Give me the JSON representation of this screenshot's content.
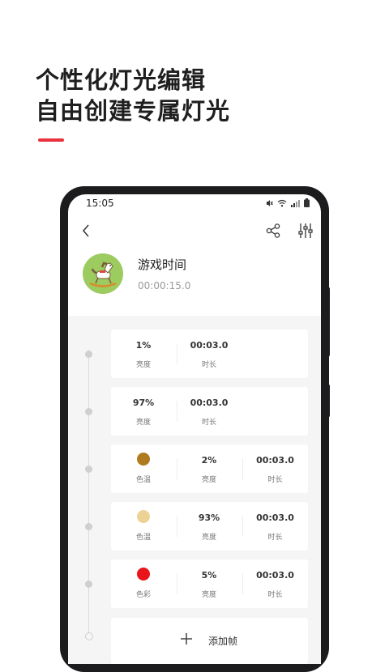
{
  "hero": {
    "line1": "个性化灯光编辑",
    "line2": "自由创建专属灯光",
    "accent_color": "#e8323c"
  },
  "statusbar": {
    "time": "15:05",
    "icons": [
      "mute-icon",
      "wifi-icon",
      "signal-icon",
      "battery-icon"
    ]
  },
  "toolbar": {
    "back_icon": "chevron-left-icon",
    "share_icon": "share-icon",
    "adjust_icon": "sliders-icon"
  },
  "scene": {
    "name": "游戏时间",
    "duration": "00:00:15.0",
    "avatar_icon": "rocking-horse-icon",
    "avatar_color": "#9ccb5f"
  },
  "frames": [
    {
      "cells": [
        {
          "value": "1%",
          "label": "亮度"
        },
        {
          "value": "00:03.0",
          "label": "时长"
        }
      ]
    },
    {
      "cells": [
        {
          "value": "97%",
          "label": "亮度"
        },
        {
          "value": "00:03.0",
          "label": "时长"
        }
      ]
    },
    {
      "cells": [
        {
          "swatch": "#b07a1e",
          "label": "色温"
        },
        {
          "value": "2%",
          "label": "亮度"
        },
        {
          "value": "00:03.0",
          "label": "时长"
        }
      ]
    },
    {
      "cells": [
        {
          "swatch": "#edd295",
          "label": "色温"
        },
        {
          "value": "93%",
          "label": "亮度"
        },
        {
          "value": "00:03.0",
          "label": "时长"
        }
      ]
    },
    {
      "cells": [
        {
          "swatch": "#e8151b",
          "label": "色彩"
        },
        {
          "value": "5%",
          "label": "亮度"
        },
        {
          "value": "00:03.0",
          "label": "时长"
        }
      ]
    }
  ],
  "add_frame": {
    "label": "添加帧",
    "icon": "plus-icon"
  }
}
